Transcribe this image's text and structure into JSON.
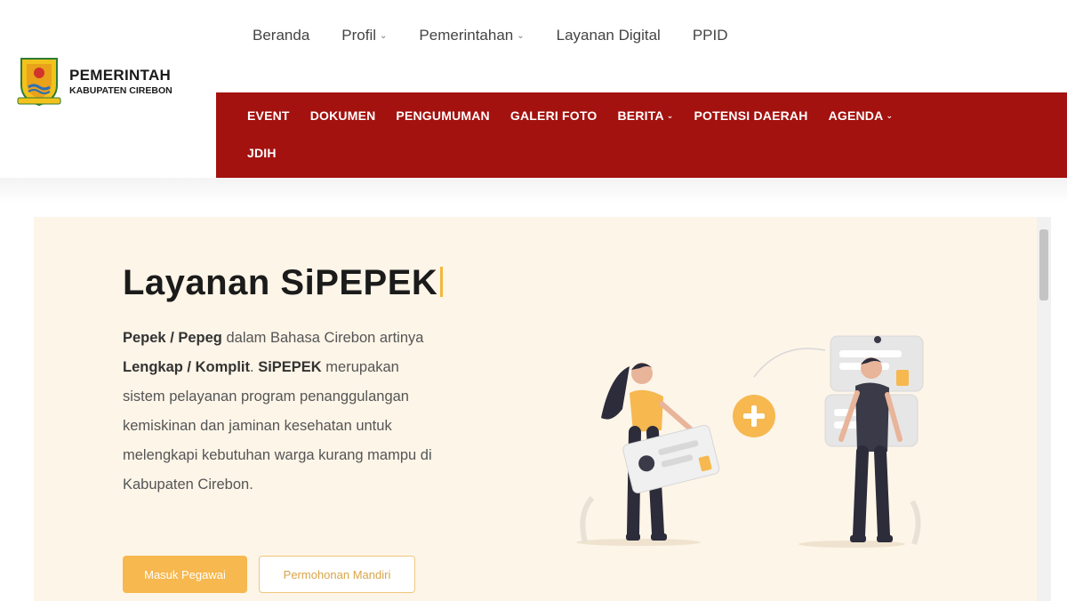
{
  "brand": {
    "line1": "PEMERINTAH",
    "line2": "KABUPATEN CIREBON"
  },
  "top_nav": [
    {
      "label": "Beranda",
      "dropdown": false
    },
    {
      "label": "Profil",
      "dropdown": true
    },
    {
      "label": "Pemerintahan",
      "dropdown": true
    },
    {
      "label": "Layanan Digital",
      "dropdown": false
    },
    {
      "label": "PPID",
      "dropdown": false
    }
  ],
  "red_nav": {
    "row1": [
      {
        "label": "EVENT",
        "dropdown": false
      },
      {
        "label": "DOKUMEN",
        "dropdown": false
      },
      {
        "label": "PENGUMUMAN",
        "dropdown": false
      },
      {
        "label": "GALERI FOTO",
        "dropdown": false
      },
      {
        "label": "BERITA",
        "dropdown": true
      },
      {
        "label": "POTENSI DAERAH",
        "dropdown": false
      },
      {
        "label": "AGENDA",
        "dropdown": true
      }
    ],
    "row2": [
      {
        "label": "JDIH",
        "dropdown": false
      }
    ]
  },
  "hero": {
    "title": "Layanan SiPEPEK",
    "desc": {
      "t1": "Pepek / Pepeg",
      "t2": " dalam Bahasa Cirebon artinya ",
      "t3": "Lengkap / Komplit",
      "t4": ". ",
      "t5": "SiPEPEK",
      "t6": " merupakan sistem pelayanan program penanggulangan kemiskinan dan jaminan kesehatan untuk melengkapi kebutuhan warga kurang mampu di Kabupaten Cirebon."
    },
    "primary_button": "Masuk Pegawai",
    "secondary_button": "Permohonan Mandiri"
  },
  "colors": {
    "nav_red": "#a3120f",
    "hero_bg": "#fdf5e8",
    "accent": "#f6b84f"
  }
}
